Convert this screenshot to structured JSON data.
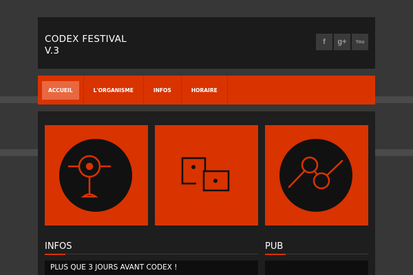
{
  "header": {
    "title": "CODEX FESTIVAL V.3",
    "social": [
      {
        "icon": "facebook-icon",
        "glyph": "f"
      },
      {
        "icon": "google-plus-icon",
        "glyph": "g+"
      },
      {
        "icon": "youtube-icon",
        "glyph": "You"
      }
    ]
  },
  "nav": {
    "items": [
      {
        "label": "ACCUEIL"
      },
      {
        "label": "L'ORGANISME"
      },
      {
        "label": "INFOS"
      },
      {
        "label": "HORAIRE"
      }
    ]
  },
  "tiles": [
    {
      "icon": "target-icon"
    },
    {
      "icon": "dice-icon"
    },
    {
      "icon": "growth-chart-icon"
    }
  ],
  "sections": {
    "infos_title": "INFOS",
    "pub_title": "PUB",
    "post_title": "PLUS QUE 3 JOURS AVANT CODEX !"
  },
  "colors": {
    "accent": "#d93300",
    "background": "#373737",
    "panel": "#1b1b1b"
  }
}
